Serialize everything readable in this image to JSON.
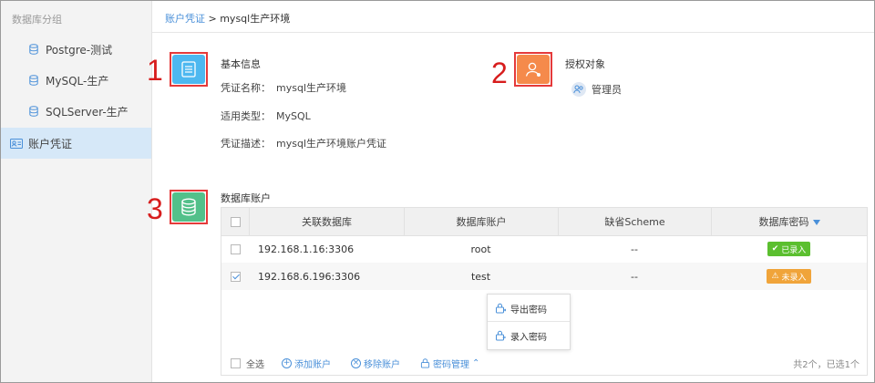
{
  "sidebar": {
    "group_label": "数据库分组",
    "items": [
      {
        "label": "Postgre-测试",
        "icon": "database-icon"
      },
      {
        "label": "MySQL-生产",
        "icon": "database-icon"
      },
      {
        "label": "SQLServer-生产",
        "icon": "database-icon"
      }
    ],
    "active_item": {
      "label": "账户凭证",
      "icon": "id-card-icon"
    }
  },
  "breadcrumb": {
    "parent": "账户凭证",
    "separator": ">",
    "current": "mysql生产环境"
  },
  "markers": [
    "1",
    "2",
    "3"
  ],
  "basic_info": {
    "title": "基本信息",
    "name_label": "凭证名称：",
    "name_value": "mysql生产环境",
    "type_label": "适用类型：",
    "type_value": "MySQL",
    "desc_label": "凭证描述：",
    "desc_value": "mysql生产环境账户凭证",
    "icon_color": "#4db8f0"
  },
  "authorized": {
    "title": "授权对象",
    "owner": "管理员",
    "icon_color": "#f58a4b"
  },
  "db_accounts": {
    "title": "数据库账户",
    "icon_color": "#53c08a",
    "columns": [
      "关联数据库",
      "数据库账户",
      "缺省Scheme",
      "数据库密码"
    ],
    "rows": [
      {
        "checked": false,
        "database": "192.168.1.16:3306",
        "account": "root",
        "scheme": "--",
        "status": "已录入",
        "status_type": "ok"
      },
      {
        "checked": true,
        "database": "192.168.6.196:3306",
        "account": "test",
        "scheme": "--",
        "status": "未录入",
        "status_type": "warn"
      }
    ],
    "popup_items": [
      "导出密码",
      "录入密码"
    ],
    "footer": {
      "select_all": "全选",
      "add": "添加账户",
      "remove": "移除账户",
      "password_mgmt": "密码管理",
      "summary": "共2个，已选1个"
    }
  },
  "colors": {
    "accent": "#4a90d9",
    "ok": "#5bbf2f",
    "warn": "#f0a43a",
    "marker": "#d71d1d"
  }
}
